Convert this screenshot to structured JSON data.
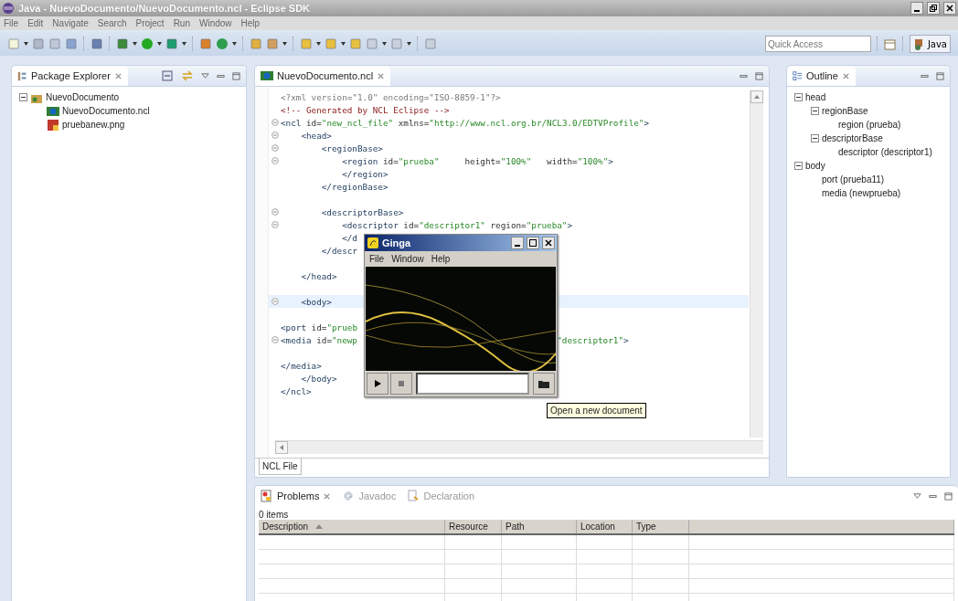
{
  "window": {
    "title": "Java - NuevoDocumento/NuevoDocumento.ncl - Eclipse SDK"
  },
  "menu": [
    "File",
    "Edit",
    "Navigate",
    "Search",
    "Project",
    "Run",
    "Window",
    "Help"
  ],
  "quick_access": {
    "placeholder": "Quick Access"
  },
  "perspective": {
    "label": "Java"
  },
  "package_explorer": {
    "title": "Package Explorer",
    "tree": [
      {
        "label": "NuevoDocumento",
        "kind": "project",
        "expanded": true,
        "children": [
          {
            "label": "NuevoDocumento.ncl",
            "kind": "ncl"
          },
          {
            "label": "pruebanew.png",
            "kind": "image"
          }
        ]
      }
    ]
  },
  "editor": {
    "tab": "NuevoDocumento.ncl",
    "bottom_tab": "NCL File",
    "lines": [
      {
        "fold": false,
        "current": false,
        "tokens": [
          {
            "kind": "decl",
            "text": "<?xml version=\"1.0\" encoding=\"ISO-8859-1\"?>"
          }
        ]
      },
      {
        "fold": false,
        "current": false,
        "tokens": [
          {
            "kind": "comment",
            "text": "<!-- Generated by NCL Eclipse -->"
          }
        ]
      },
      {
        "fold": true,
        "current": false,
        "tokens": [
          {
            "kind": "tag",
            "text": "<ncl "
          },
          {
            "kind": "attr",
            "text": "id="
          },
          {
            "kind": "value",
            "text": "\"new_ncl_file\""
          },
          {
            "kind": "attr",
            "text": " xmlns="
          },
          {
            "kind": "value",
            "text": "\"http://www.ncl.org.br/NCL3.0/EDTVProfile\""
          },
          {
            "kind": "tag",
            "text": ">"
          }
        ]
      },
      {
        "fold": true,
        "current": false,
        "tokens": [
          {
            "kind": "tag",
            "text": "    <head>"
          }
        ]
      },
      {
        "fold": true,
        "current": false,
        "tokens": [
          {
            "kind": "tag",
            "text": "        <regionBase>"
          }
        ]
      },
      {
        "fold": true,
        "current": false,
        "tokens": [
          {
            "kind": "tag",
            "text": "            <region "
          },
          {
            "kind": "attr",
            "text": "id="
          },
          {
            "kind": "value",
            "text": "\"prueba\""
          },
          {
            "kind": "attr",
            "text": "     height="
          },
          {
            "kind": "value",
            "text": "\"100%\""
          },
          {
            "kind": "attr",
            "text": "   width="
          },
          {
            "kind": "value",
            "text": "\"100%\""
          },
          {
            "kind": "tag",
            "text": ">"
          }
        ]
      },
      {
        "fold": false,
        "current": false,
        "tokens": [
          {
            "kind": "tag",
            "text": "            </region>"
          }
        ]
      },
      {
        "fold": false,
        "current": false,
        "tokens": [
          {
            "kind": "tag",
            "text": "        </regionBase>"
          }
        ]
      },
      {
        "fold": false,
        "current": false
      },
      {
        "fold": true,
        "current": false,
        "tokens": [
          {
            "kind": "tag",
            "text": "        <descriptorBase>"
          }
        ]
      },
      {
        "fold": true,
        "current": false,
        "tokens": [
          {
            "kind": "tag",
            "text": "            <descriptor "
          },
          {
            "kind": "attr",
            "text": "id="
          },
          {
            "kind": "value",
            "text": "\"descriptor1\""
          },
          {
            "kind": "attr",
            "text": " region="
          },
          {
            "kind": "value",
            "text": "\"prueba\""
          },
          {
            "kind": "tag",
            "text": ">"
          }
        ]
      },
      {
        "fold": false,
        "current": false,
        "tokens": [
          {
            "kind": "tag",
            "text": "            </d"
          }
        ]
      },
      {
        "fold": false,
        "current": false,
        "tokens": [
          {
            "kind": "tag",
            "text": "        </descr"
          }
        ]
      },
      {
        "fold": false,
        "current": false
      },
      {
        "fold": false,
        "current": false,
        "tokens": [
          {
            "kind": "tag",
            "text": "    </head>"
          }
        ]
      },
      {
        "fold": false,
        "current": false
      },
      {
        "fold": true,
        "current": true,
        "tokens": [
          {
            "kind": "tag",
            "text": "    <body>"
          }
        ]
      },
      {
        "fold": false,
        "current": false
      },
      {
        "fold": false,
        "current": false,
        "tokens": [
          {
            "kind": "tag",
            "text": "<port "
          },
          {
            "kind": "attr",
            "text": "id="
          },
          {
            "kind": "value",
            "text": "\"prueb"
          }
        ]
      },
      {
        "fold": true,
        "current": false,
        "tokens": [
          {
            "kind": "tag",
            "text": "<media "
          },
          {
            "kind": "attr",
            "text": "id="
          },
          {
            "kind": "value",
            "text": "\"newp"
          }
        ],
        "after": [
          {
            "kind": "value",
            "text": "\"descriptor1\""
          },
          {
            "kind": "tag",
            "text": ">"
          }
        ]
      },
      {
        "fold": false,
        "current": false
      },
      {
        "fold": false,
        "current": false,
        "tokens": [
          {
            "kind": "tag",
            "text": "</media>"
          }
        ]
      },
      {
        "fold": false,
        "current": false,
        "tokens": [
          {
            "kind": "tag",
            "text": "    </body>"
          }
        ]
      },
      {
        "fold": false,
        "current": false,
        "tokens": [
          {
            "kind": "tag",
            "text": "</ncl>"
          }
        ]
      }
    ]
  },
  "outline": {
    "title": "Outline",
    "tree": [
      {
        "label": "head",
        "expanded": true,
        "children": [
          {
            "label": "regionBase",
            "expanded": true,
            "children": [
              {
                "label": "region (prueba)"
              }
            ]
          },
          {
            "label": "descriptorBase",
            "expanded": true,
            "children": [
              {
                "label": "descriptor (descriptor1)"
              }
            ]
          }
        ]
      },
      {
        "label": "body",
        "expanded": true,
        "children": [
          {
            "label": "port (prueba11)"
          },
          {
            "label": "media (newprueba)"
          }
        ]
      }
    ]
  },
  "ginga": {
    "title": "Ginga",
    "menu": [
      "File",
      "Window",
      "Help"
    ],
    "tooltip": "Open a new document"
  },
  "problems": {
    "tabs": [
      {
        "label": "Problems",
        "kind": "problems",
        "selected": true
      },
      {
        "label": "Javadoc",
        "kind": "javadoc",
        "selected": false
      },
      {
        "label": "Declaration",
        "kind": "declaration",
        "selected": false
      }
    ],
    "summary": "0 items",
    "columns": [
      {
        "label": "Description",
        "sorted": true
      },
      {
        "label": "Resource",
        "sorted": false
      },
      {
        "label": "Path",
        "sorted": false
      },
      {
        "label": "Location",
        "sorted": false
      },
      {
        "label": "Type",
        "sorted": false
      }
    ]
  }
}
